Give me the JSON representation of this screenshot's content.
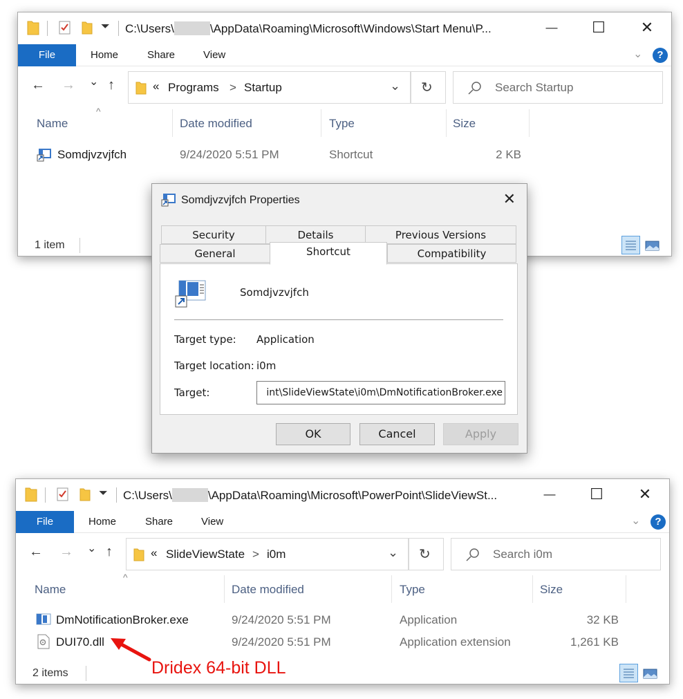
{
  "window1": {
    "title_path_start": "C:\\Users\\",
    "title_path_end": "\\AppData\\Roaming\\Microsoft\\Windows\\Start Menu\\P...",
    "ribbon": {
      "file": "File",
      "home": "Home",
      "share": "Share",
      "view": "View",
      "help": "?"
    },
    "breadcrumb": {
      "overflow": "«",
      "items": [
        "Programs",
        "Startup"
      ],
      "sep": ">"
    },
    "search_placeholder": "Search Startup",
    "columns": {
      "name": "Name",
      "date": "Date modified",
      "type": "Type",
      "size": "Size"
    },
    "rows": [
      {
        "name": "Somdjvzvjfch",
        "date": "9/24/2020 5:51 PM",
        "type": "Shortcut",
        "size": "2 KB"
      }
    ],
    "status": "1 item"
  },
  "dialog": {
    "title": "Somdjvzvjfch Properties",
    "tabs_row1": [
      "Security",
      "Details",
      "Previous Versions"
    ],
    "tabs_row2": [
      "General",
      "Shortcut",
      "Compatibility"
    ],
    "selected_tab": "Shortcut",
    "file_name": "Somdjvzvjfch",
    "target_type_label": "Target type:",
    "target_type_value": "Application",
    "target_location_label": "Target location:",
    "target_location_value": "i0m",
    "target_label": "Target:",
    "target_value": "int\\SlideViewState\\i0m\\DmNotificationBroker.exe",
    "buttons": {
      "ok": "OK",
      "cancel": "Cancel",
      "apply": "Apply"
    }
  },
  "window2": {
    "title_path_start": "C:\\Users\\",
    "title_path_end": "\\AppData\\Roaming\\Microsoft\\PowerPoint\\SlideViewSt...",
    "ribbon": {
      "file": "File",
      "home": "Home",
      "share": "Share",
      "view": "View",
      "help": "?"
    },
    "breadcrumb": {
      "overflow": "«",
      "items": [
        "SlideViewState",
        "i0m"
      ],
      "sep": ">"
    },
    "search_placeholder": "Search i0m",
    "columns": {
      "name": "Name",
      "date": "Date modified",
      "type": "Type",
      "size": "Size"
    },
    "rows": [
      {
        "name": "DmNotificationBroker.exe",
        "date": "9/24/2020 5:51 PM",
        "type": "Application",
        "size": "32 KB"
      },
      {
        "name": "DUI70.dll",
        "date": "9/24/2020 5:51 PM",
        "type": "Application extension",
        "size": "1,261 KB"
      }
    ],
    "status": "2 items"
  },
  "annotation": {
    "text": "Dridex 64-bit DLL",
    "color": "#e8140f"
  },
  "colors": {
    "ribbon_file_tab": "#1a6cc4",
    "column_header": "#4c6083",
    "annotation": "#e8140f"
  },
  "window_controls": {
    "minimize": "—",
    "maximize": "☐",
    "close": "✕"
  },
  "nav_glyphs": {
    "back": "←",
    "forward": "→",
    "recent": "⌄",
    "up": "↑",
    "refresh": "↻",
    "dropdown": "⌄",
    "ribbon_expand": "⌄",
    "sort_up": "^"
  }
}
